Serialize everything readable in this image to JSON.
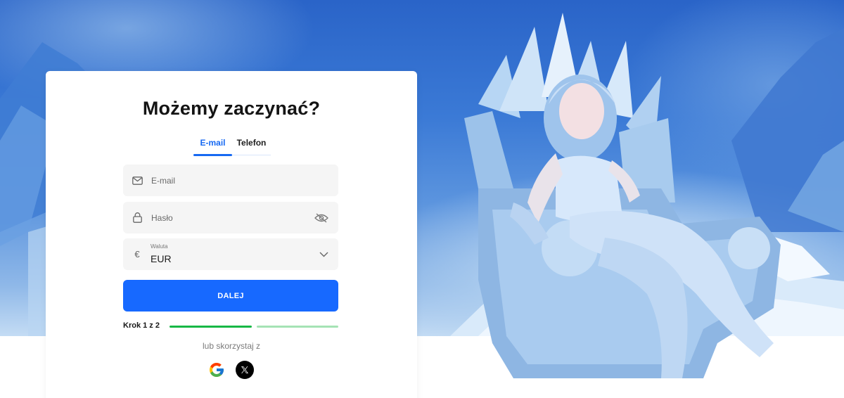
{
  "login": {
    "title": "Możemy zaczynać?",
    "tabs": [
      {
        "label": "E-mail",
        "active": true
      },
      {
        "label": "Telefon",
        "active": false
      }
    ],
    "email_placeholder": "E-mail",
    "password_placeholder": "Hasło",
    "currency": {
      "label": "Waluta",
      "value": "EUR",
      "symbol": "€"
    },
    "submit_label": "DALEJ",
    "step_label": "Krok 1 z 2",
    "step": {
      "current": 1,
      "total": 2
    },
    "alt_label": "lub skorzystaj z",
    "social": [
      "google-icon",
      "x-icon"
    ]
  },
  "colors": {
    "accent": "#1769ff",
    "progress_done": "#17b846",
    "progress_todo": "#a5e3b5"
  }
}
